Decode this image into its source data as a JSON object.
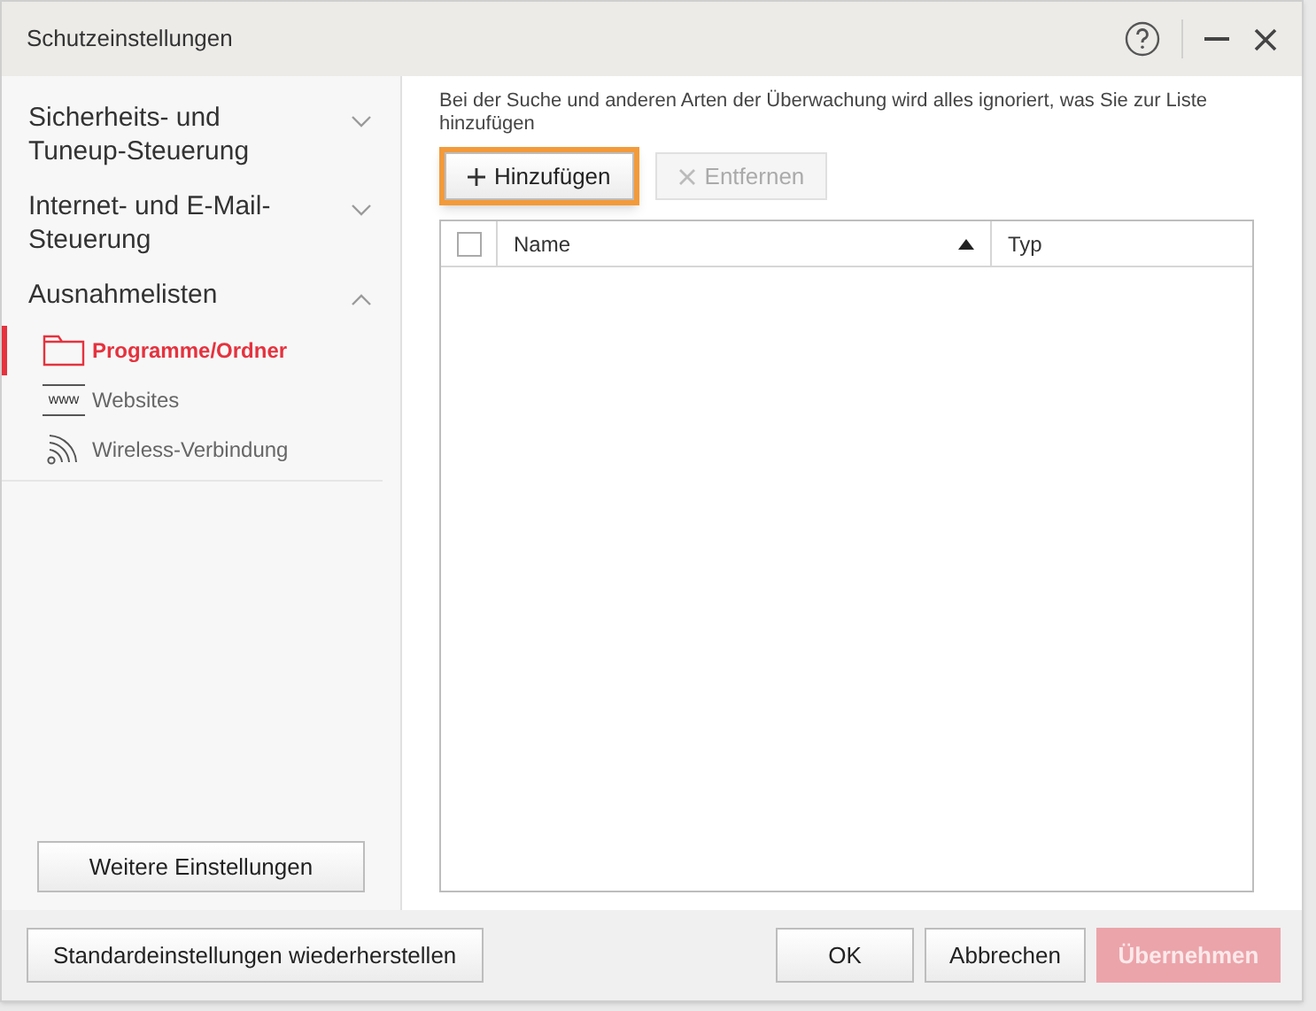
{
  "window": {
    "title": "Schutzeinstellungen"
  },
  "sidebar": {
    "sections": [
      {
        "label": "Sicherheits- und Tuneup-Steuerung",
        "expanded": false
      },
      {
        "label": "Internet- und E-Mail-Steuerung",
        "expanded": false
      },
      {
        "label": "Ausnahmelisten",
        "expanded": true,
        "items": [
          {
            "label": "Programme/Ordner",
            "selected": true,
            "kind": "folder"
          },
          {
            "label": "Websites",
            "selected": false,
            "kind": "web",
            "icon_text": "www"
          },
          {
            "label": "Wireless-Verbindung",
            "selected": false,
            "kind": "wireless"
          }
        ]
      }
    ],
    "more_button": "Weitere Einstellungen"
  },
  "content": {
    "description": "Bei der Suche und anderen Arten der Überwachung wird alles ignoriert, was Sie zur Liste hinzufügen",
    "buttons": [
      {
        "label": "Hinzufügen",
        "kind": "add",
        "disabled": false,
        "highlighted": true
      },
      {
        "label": "Entfernen",
        "kind": "remove",
        "disabled": true,
        "highlighted": false
      }
    ],
    "table": {
      "select_all_checked": false,
      "columns": [
        {
          "label": "Name",
          "sorted": true
        },
        {
          "label": "Typ",
          "sorted": false
        }
      ]
    }
  },
  "footer": {
    "reset_button": "Standardeinstellungen wiederherstellen",
    "buttons": [
      {
        "label": "OK",
        "kind": "normal",
        "disabled": false
      },
      {
        "label": "Abbrechen",
        "kind": "normal",
        "disabled": false
      },
      {
        "label": "Übernehmen",
        "kind": "primary",
        "disabled": true
      }
    ]
  }
}
